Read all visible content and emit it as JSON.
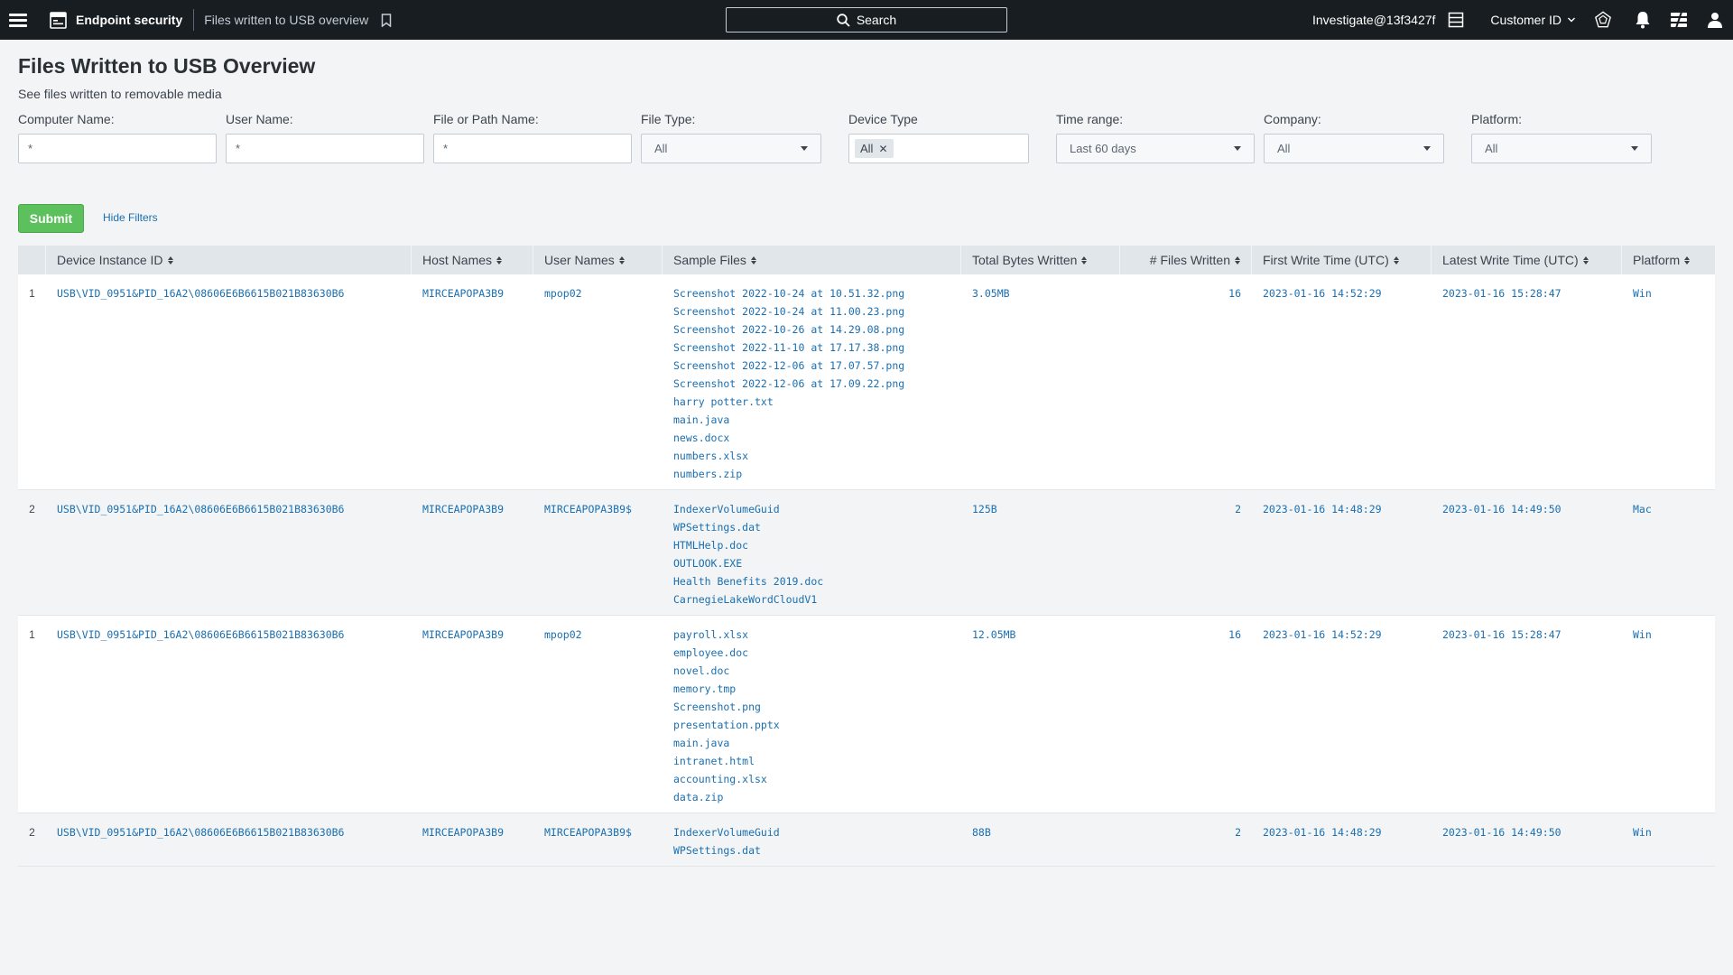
{
  "topbar": {
    "app_name": "Endpoint security",
    "page_crumb": "Files written to USB overview",
    "search_label": "Search",
    "user": "Investigate@13f3427f",
    "customer_label": "Customer ID"
  },
  "header": {
    "title": "Files Written to USB Overview",
    "description": "See files written to removable media"
  },
  "filters": {
    "computer_name": {
      "label": "Computer Name:",
      "value": "*"
    },
    "user_name": {
      "label": "User Name:",
      "value": "*"
    },
    "file_path": {
      "label": "File or Path Name:",
      "value": "*"
    },
    "file_type": {
      "label": "File Type:",
      "value": "All"
    },
    "device_type": {
      "label": "Device Type",
      "token": "All"
    },
    "time_range": {
      "label": "Time range:",
      "value": "Last 60 days"
    },
    "company": {
      "label": "Company:",
      "value": "All"
    },
    "platform": {
      "label": "Platform:",
      "value": "All"
    },
    "submit_label": "Submit",
    "hide_filters_label": "Hide Filters"
  },
  "table": {
    "columns": [
      "",
      "Device Instance ID",
      "Host Names",
      "User Names",
      "Sample Files",
      "Total Bytes Written",
      "# Files Written",
      "First Write Time (UTC)",
      "Latest Write Time (UTC)",
      "Platform"
    ],
    "rows": [
      {
        "num": "1",
        "device_id": "USB\\VID_0951&PID_16A2\\08606E6B6615B021B83630B6",
        "host": "MIRCEAPOPA3B9",
        "user": "mpop02",
        "files": [
          "Screenshot 2022-10-24 at 10.51.32.png",
          "Screenshot 2022-10-24 at 11.00.23.png",
          "Screenshot 2022-10-26 at 14.29.08.png",
          "Screenshot 2022-11-10 at 17.17.38.png",
          "Screenshot 2022-12-06 at 17.07.57.png",
          "Screenshot 2022-12-06 at 17.09.22.png",
          "harry potter.txt",
          "main.java",
          "news.docx",
          "numbers.xlsx",
          "numbers.zip"
        ],
        "total_bytes": "3.05MB",
        "files_written": "16",
        "first_write": "2023-01-16 14:52:29",
        "latest_write": "2023-01-16 15:28:47",
        "platform": "Win"
      },
      {
        "num": "2",
        "device_id": "USB\\VID_0951&PID_16A2\\08606E6B6615B021B83630B6",
        "host": "MIRCEAPOPA3B9",
        "user": "MIRCEAPOPA3B9$",
        "files": [
          "IndexerVolumeGuid",
          "WPSettings.dat",
          "HTMLHelp.doc",
          "OUTLOOK.EXE",
          "Health Benefits 2019.doc",
          "CarnegieLakeWordCloudV1"
        ],
        "total_bytes": "125B",
        "files_written": "2",
        "first_write": "2023-01-16 14:48:29",
        "latest_write": "2023-01-16 14:49:50",
        "platform": "Mac"
      },
      {
        "num": "1",
        "device_id": "USB\\VID_0951&PID_16A2\\08606E6B6615B021B83630B6",
        "host": "MIRCEAPOPA3B9",
        "user": "mpop02",
        "files": [
          "payroll.xlsx",
          "employee.doc",
          "novel.doc",
          "memory.tmp",
          "Screenshot.png",
          "presentation.pptx",
          "main.java",
          "intranet.html",
          "accounting.xlsx",
          "data.zip"
        ],
        "total_bytes": "12.05MB",
        "files_written": "16",
        "first_write": "2023-01-16 14:52:29",
        "latest_write": "2023-01-16 15:28:47",
        "platform": "Win"
      },
      {
        "num": "2",
        "device_id": "USB\\VID_0951&PID_16A2\\08606E6B6615B021B83630B6",
        "host": "MIRCEAPOPA3B9",
        "user": "MIRCEAPOPA3B9$",
        "files": [
          "IndexerVolumeGuid",
          "WPSettings.dat"
        ],
        "total_bytes": "88B",
        "files_written": "2",
        "first_write": "2023-01-16 14:48:29",
        "latest_write": "2023-01-16 14:49:50",
        "platform": "Win"
      }
    ]
  },
  "colors": {
    "topbar_bg": "#171d21",
    "page_bg": "#f2f4f5",
    "link": "#1a6fb0",
    "submit": "#5cc05c"
  },
  "icons": [
    "hamburger-icon",
    "app-icon",
    "bookmark-icon",
    "search-icon",
    "layout-icon",
    "chevron-down-icon",
    "badge-icon",
    "bell-icon",
    "messages-icon",
    "user-icon"
  ]
}
